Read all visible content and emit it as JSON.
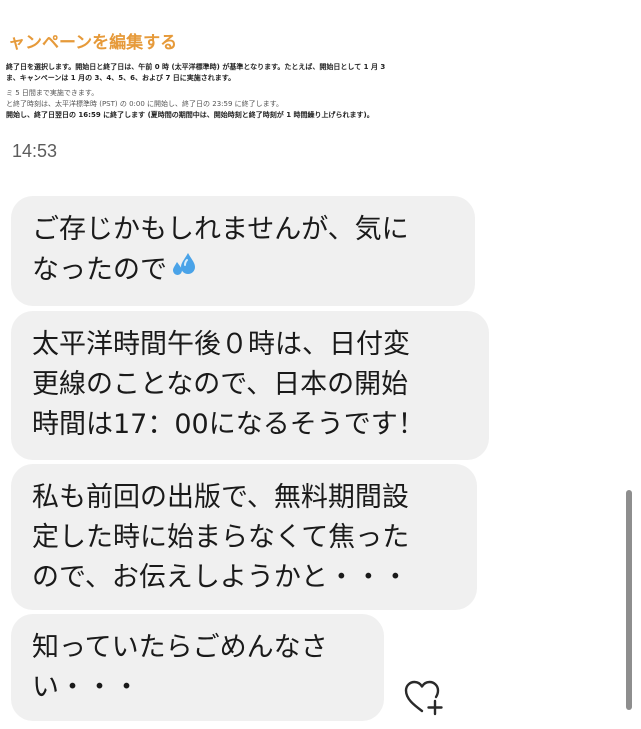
{
  "shared_image": {
    "title": "ャンペーンを編集する",
    "lines": [
      "終了日を選択します。開始日と終了日は、午前 0 時 (太平洋標準時) が基準となります。たとえば、開始日として 1 月 3",
      "ま、キャンペーンは 1 月の 3、4、5、6、および 7 日に実施されます。",
      "ミ 5 日間まで実施できます。",
      "と終了時刻は、太平洋標準時 (PST) の 0:00 に開始し、終了日の 23:59 に終了します。",
      "開始し、終了日翌日の 16:59 に終了します (夏時間の期間中は、開始時刻と終了時刻が 1 時間繰り上げられます)。"
    ]
  },
  "timestamp": "14:53",
  "messages": [
    {
      "lines": [
        "ご存じかもしれませんが、気に",
        "なったので"
      ],
      "emoji": "sweat-droplets"
    },
    {
      "lines": [
        "太平洋時間午後０時は、日付変",
        "更線のことなので、日本の開始",
        "時間は17：00になるそうです！"
      ]
    },
    {
      "lines": [
        "私も前回の出版で、無料期間設",
        "定した時に始まらなくて焦った",
        "ので、お伝えしようかと・・・"
      ]
    },
    {
      "lines": [
        "知っていたらごめんなさ",
        "い・・・"
      ]
    }
  ],
  "icons": {
    "react": "heart-plus-icon",
    "emoji": "sweat-droplets-icon"
  },
  "colors": {
    "bubble": "#f0f0f0",
    "title_orange": "#e69a3a",
    "text": "#1a1a1a"
  }
}
